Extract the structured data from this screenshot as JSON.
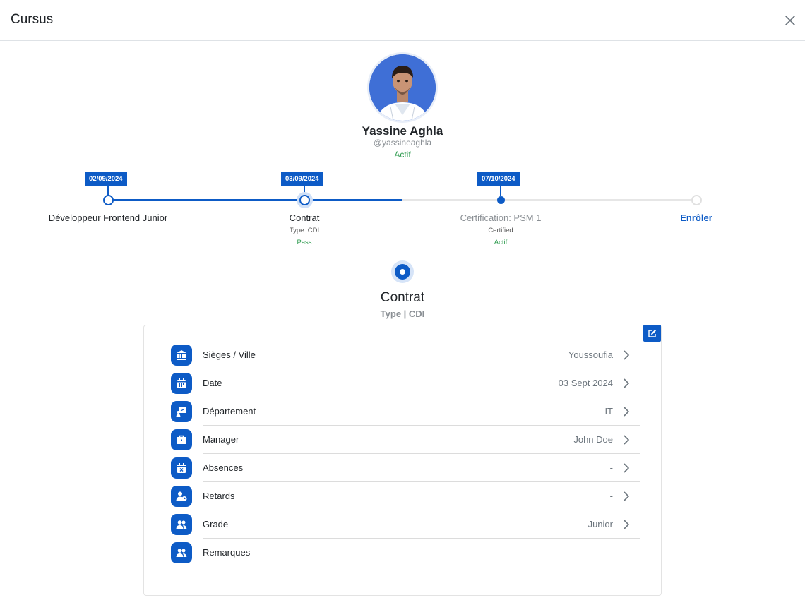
{
  "modal": {
    "title": "Cursus"
  },
  "profile": {
    "name": "Yassine Aghla",
    "handle": "@yassineaghla",
    "status": "Actif"
  },
  "timeline": {
    "steps": [
      {
        "date": "02/09/2024",
        "label": "Développeur Frontend Junior",
        "sub": "",
        "status": ""
      },
      {
        "date": "03/09/2024",
        "label": "Contrat",
        "sub": "Type: CDI",
        "status": "Pass"
      },
      {
        "date": "07/10/2024",
        "label": "Certification: PSM 1",
        "sub": "Certified",
        "status": "Actif"
      },
      {
        "date": "",
        "label": "Enrôler",
        "sub": "",
        "status": ""
      }
    ],
    "progress": 0.5
  },
  "section": {
    "title": "Contrat",
    "subtitle": "Type | CDI"
  },
  "details": {
    "rows": [
      {
        "icon": "bank-icon",
        "label": "Sièges / Ville",
        "value": "Youssoufia"
      },
      {
        "icon": "calendar-icon",
        "label": "Date",
        "value": "03 Sept 2024"
      },
      {
        "icon": "presentation-icon",
        "label": "Département",
        "value": "IT"
      },
      {
        "icon": "briefcase-icon",
        "label": "Manager",
        "value": "John Doe"
      },
      {
        "icon": "calendar-x-icon",
        "label": "Absences",
        "value": "-"
      },
      {
        "icon": "user-clock-icon",
        "label": "Retards",
        "value": "-"
      },
      {
        "icon": "users-icon",
        "label": "Grade",
        "value": "Junior"
      },
      {
        "icon": "users-icon",
        "label": "Remarques",
        "value": ""
      }
    ]
  },
  "colors": {
    "primary": "#0d5bc6",
    "success": "#2e9b4f",
    "muted": "#8a8f94"
  }
}
